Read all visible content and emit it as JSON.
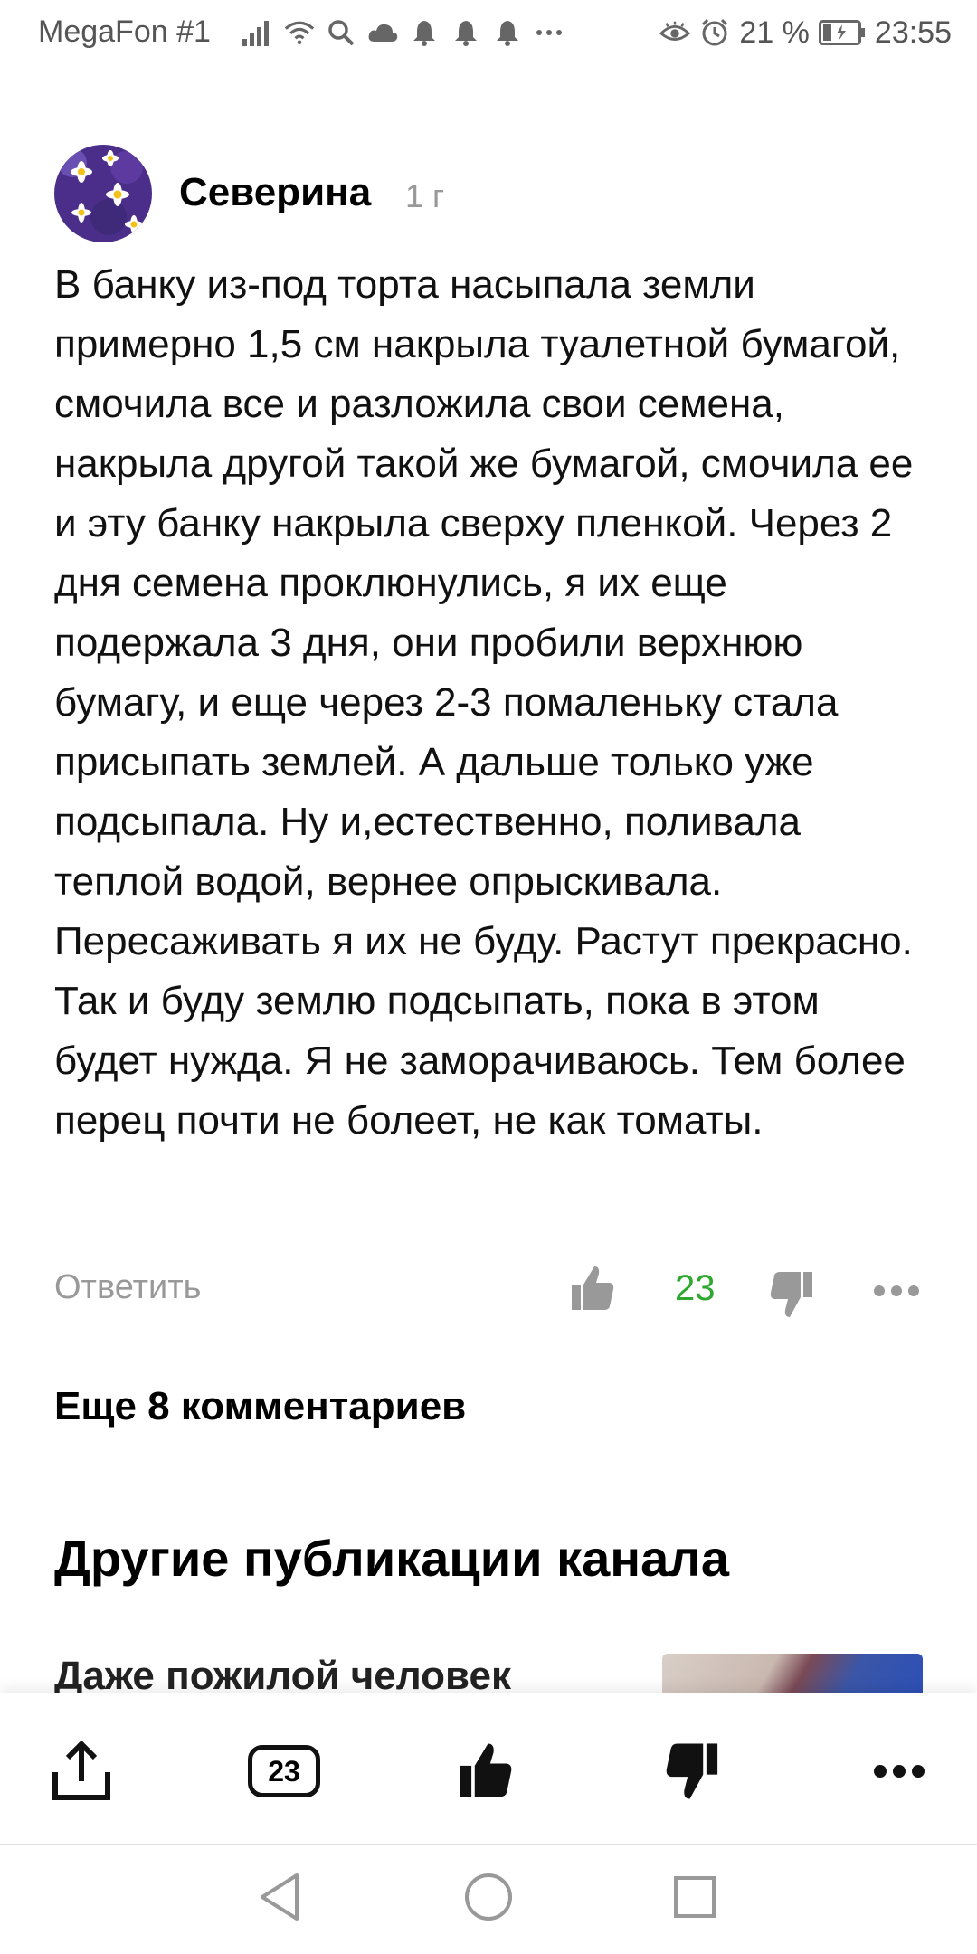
{
  "status_bar": {
    "carrier": "MegaFon #1",
    "battery": "21 %",
    "time": "23:55"
  },
  "comment": {
    "author": "Северина",
    "age": "1 г",
    "text": "В банку из-под торта насыпала земли примерно 1,5 см накрыла туалетной бумагой, смочила все и разложила свои семена, накрыла другой такой же бумагой, смочила ее и эту банку накрыла сверху пленкой. Через 2 дня семена проклюнулись, я их еще подержала 3 дня, они пробили верхнюю бумагу, и еще через 2-3 помаленьку стала присыпать землей. А дальше только уже подсыпала. Ну и,естественно, поливала теплой водой, вернее опрыскивала. Пересаживать я их не буду. Растут прекрасно. Так и буду землю подсыпать, пока в этом будет нужда. Я не заморачиваюсь. Тем более перец почти не болеет, не как томаты.",
    "reply_label": "Ответить",
    "likes": "23",
    "like_color": "#2ea82e"
  },
  "more_comments": "Еще 8 комментариев",
  "section_title": "Другие публикации канала",
  "teaser_title": "Даже пожилой человек",
  "toolbar": {
    "comments_count": "23"
  }
}
